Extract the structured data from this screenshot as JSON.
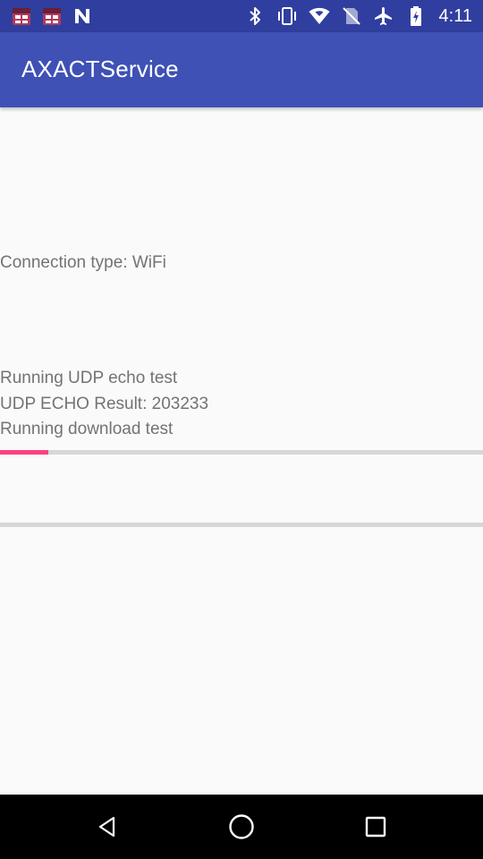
{
  "status_bar": {
    "time": "4:11",
    "left_icons": [
      "calendar-icon",
      "calendar-icon",
      "n-notification-icon"
    ],
    "right_icons": [
      "bluetooth-icon",
      "vibrate-icon",
      "wifi-icon",
      "no-sim-icon",
      "airplane-mode-icon",
      "battery-icon"
    ]
  },
  "app_bar": {
    "title": "AXACTService"
  },
  "content": {
    "connection_type": "Connection type: WiFi",
    "log": [
      "Running UDP echo test",
      "UDP ECHO Result: 203233",
      "Running download test"
    ],
    "download_progress": 0.1
  },
  "nav_bar": {
    "buttons": [
      "back-icon",
      "home-icon",
      "recents-icon"
    ]
  },
  "colors": {
    "status_bar": "#303f9f",
    "app_bar": "#3f51b5",
    "accent": "#ff4081",
    "background": "#fafafa",
    "text": "#737373"
  }
}
